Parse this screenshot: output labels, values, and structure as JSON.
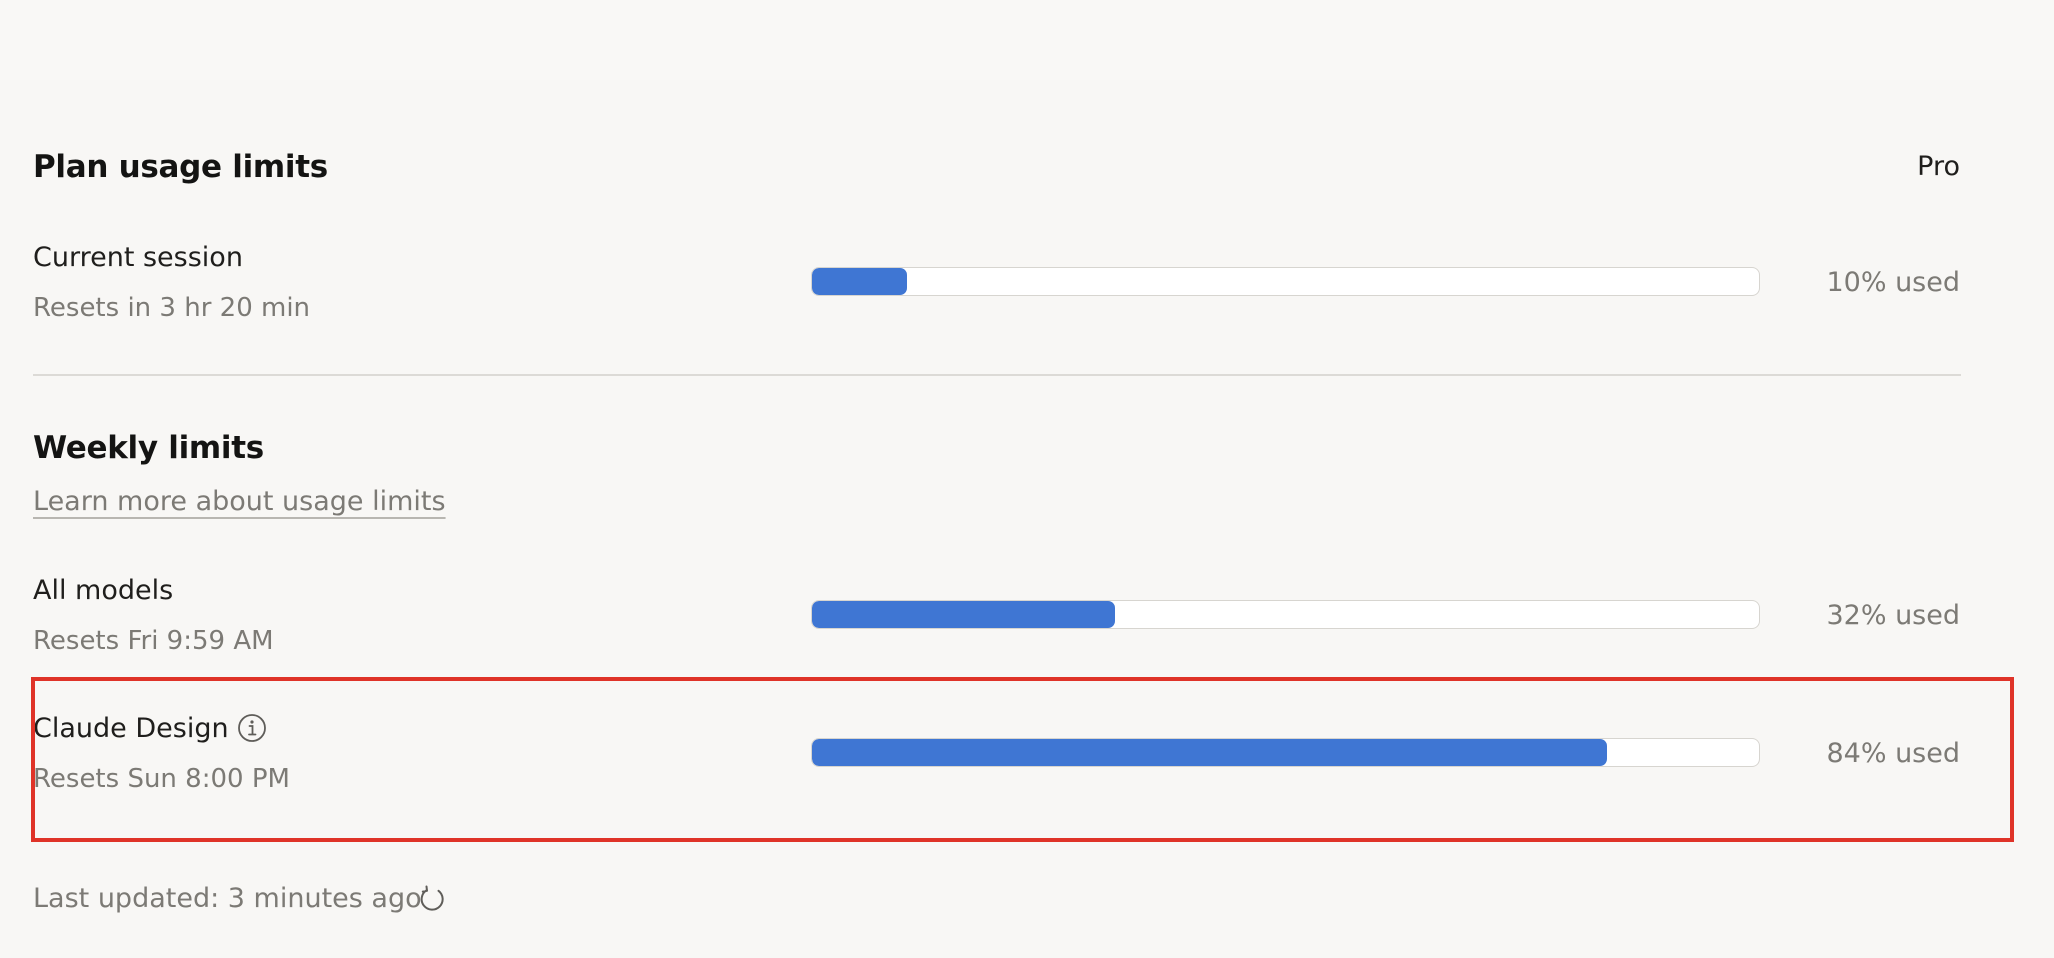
{
  "plan": {
    "title": "Plan usage limits",
    "plan_name": "Pro"
  },
  "current_session": {
    "label": "Current session",
    "resets": "Resets in 3 hr 20 min",
    "usage_fraction": 0.1,
    "usage_text": "10% used"
  },
  "weekly": {
    "title": "Weekly limits",
    "learn_more": "Learn more about usage limits",
    "items": [
      {
        "label": "All models",
        "resets": "Resets Fri 9:59 AM",
        "usage_fraction": 0.32,
        "usage_text": "32% used",
        "info_icon": false
      },
      {
        "label": "Claude Design",
        "resets": "Resets Sun 8:00 PM",
        "usage_fraction": 0.84,
        "usage_text": "84% used",
        "info_icon": "info-icon"
      }
    ]
  },
  "footer": {
    "last_updated": "Last updated: 3 minutes ago",
    "refresh_icon": "refresh-icon"
  },
  "colors": {
    "bar_fill": "#3f76d3",
    "bar_track": "#ffffff",
    "highlight": "#df3328",
    "background": "#f8f7f5"
  }
}
